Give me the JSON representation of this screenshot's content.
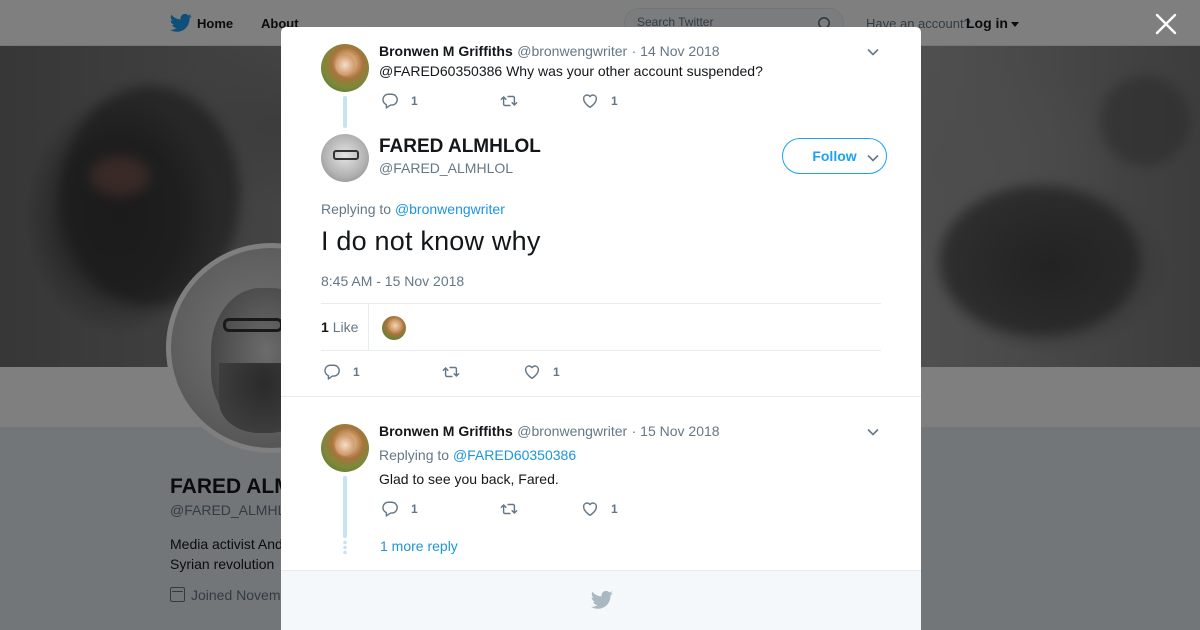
{
  "nav": {
    "home_label": "Home",
    "about_label": "About",
    "search_placeholder": "Search Twitter",
    "have_account": "Have an account?",
    "login_label": "Log in"
  },
  "profile": {
    "name": "FARED ALMHL",
    "handle": "@FARED_ALMHL",
    "bio_line1": "Media activist And",
    "bio_line2": "Syrian revolution",
    "joined": "Joined Novem"
  },
  "colors": {
    "accent": "#1da1f2",
    "link": "#1b95e0",
    "muted": "#657786",
    "thread_line": "#c4e4f6"
  },
  "modal": {
    "parent_tweet": {
      "author_name": "Bronwen M Griffiths",
      "author_handle": "@bronwengwriter",
      "date": "· 14 Nov 2018",
      "text": "@FARED60350386 Why was your other account suspended?",
      "replies": "1",
      "retweets": "",
      "likes": "1"
    },
    "main_tweet": {
      "author_name": "FARED ALMHLOL",
      "author_handle": "@FARED_ALMHLOL",
      "follow_label": "Follow",
      "replying_prefix": "Replying to",
      "replying_to": "@bronwengwriter",
      "text": "I do not know why",
      "timestamp": "8:45 AM - 15 Nov 2018",
      "like_count": "1",
      "like_word": "Like",
      "replies": "1",
      "retweets": "",
      "likes": "1"
    },
    "reply_tweet": {
      "author_name": "Bronwen M Griffiths",
      "author_handle": "@bronwengwriter",
      "date": "· 15 Nov 2018",
      "replying_prefix": "Replying to",
      "replying_to": "@FARED60350386",
      "text": "Glad to see you back, Fared.",
      "replies": "1",
      "retweets": "",
      "likes": "1",
      "more_replies": "1 more reply"
    }
  },
  "icons": [
    "twitter-bird-icon",
    "search-icon",
    "close-icon",
    "chevron-down-icon",
    "reply-icon",
    "retweet-icon",
    "heart-icon",
    "calendar-icon"
  ]
}
